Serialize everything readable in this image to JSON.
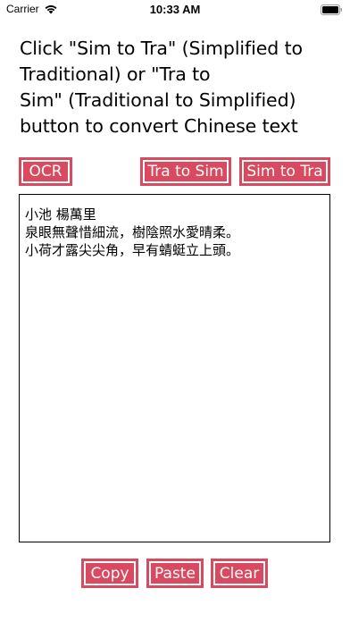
{
  "status_bar": {
    "carrier": "Carrier",
    "time": "10:33 AM",
    "wifi_icon": "wifi-icon",
    "battery_icon": "battery-icon"
  },
  "instructions": {
    "line1": "Click \"Sim to Tra\" (Simplified to",
    "line2": "Traditional) or \"Tra to",
    "line3": "Sim\" (Traditional to Simplified)",
    "line4": "button to convert Chinese text"
  },
  "toolbar": {
    "ocr_label": "OCR",
    "tra_to_sim_label": "Tra to Sim",
    "sim_to_tra_label": "Sim to Tra"
  },
  "editor": {
    "lines": [
      "小池 楊萬里",
      "泉眼無聲惜細流，樹陰照水愛晴柔。",
      "小荷才露尖尖角，早有蜻蜓立上頭。"
    ]
  },
  "actions": {
    "copy_label": "Copy",
    "paste_label": "Paste",
    "clear_label": "Clear"
  },
  "colors": {
    "accent": "#d9495f",
    "button_text": "#ffffff",
    "background": "#ffffff"
  }
}
